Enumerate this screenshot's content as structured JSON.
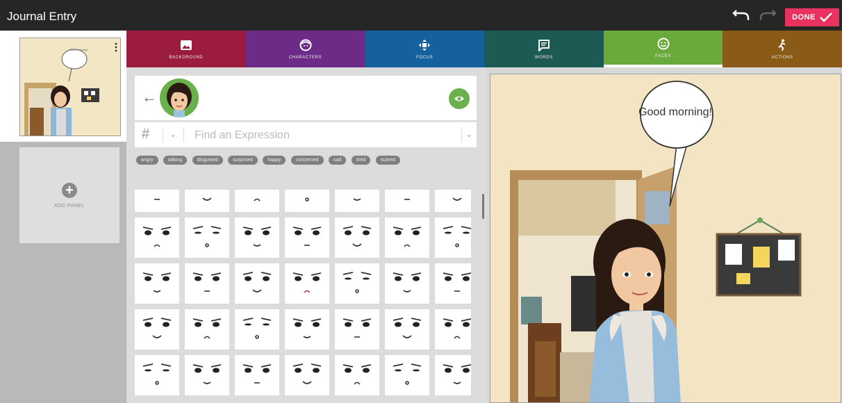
{
  "header": {
    "title": "Journal Entry",
    "done_label": "DONE",
    "accent_color": "#e9325f"
  },
  "sidebar": {
    "thumbnail_text": "Good morning!",
    "add_panel_label": "ADD PANEL"
  },
  "tabs": [
    {
      "label": "BACKGROUND",
      "icon": "image-icon",
      "color": "#9b1c3c"
    },
    {
      "label": "CHARACTERS",
      "icon": "face-icon",
      "color": "#6b2b86"
    },
    {
      "label": "FOCUS",
      "icon": "move-icon",
      "color": "#15619e"
    },
    {
      "label": "WORDS",
      "icon": "speech-icon",
      "color": "#1d5a53"
    },
    {
      "label": "FACES",
      "icon": "smiley-icon",
      "color": "#6aaa3c"
    },
    {
      "label": "ACTIONS",
      "icon": "walking-icon",
      "color": "#8a5a17"
    }
  ],
  "expressions": {
    "search_prefix": "#",
    "placeholder": "Find an Expression",
    "tags": [
      "angry",
      "talking",
      "disgusted",
      "surprised",
      "happy",
      "concerned",
      "sad",
      "tired",
      "scared"
    ]
  },
  "scene": {
    "speech_bubble": "Good morning!"
  }
}
